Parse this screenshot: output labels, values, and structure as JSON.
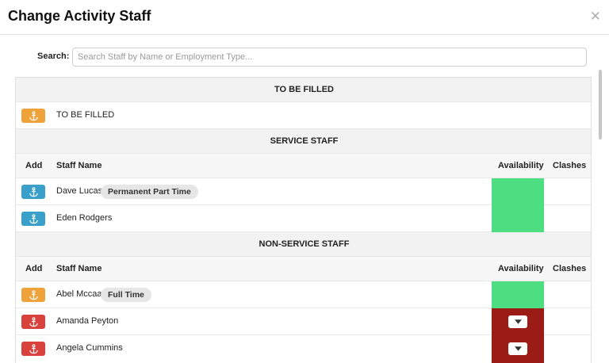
{
  "modal": {
    "title": "Change Activity Staff",
    "close_icon": "close-icon"
  },
  "search": {
    "label": "Search:",
    "placeholder": "Search Staff by Name or Employment Type...",
    "value": ""
  },
  "columns": {
    "add": "Add",
    "staff_name": "Staff Name",
    "availability": "Availability",
    "clashes": "Clashes"
  },
  "sections": {
    "to_be_filled": {
      "title": "TO BE FILLED",
      "rows": [
        {
          "name": "TO BE FILLED",
          "button_color": "orange",
          "icon": "anchor-icon"
        }
      ]
    },
    "service_staff": {
      "title": "SERVICE STAFF",
      "rows": [
        {
          "name": "Dave Lucas",
          "badge": "Permanent Part Time",
          "button_color": "blue",
          "icon": "anchor-icon",
          "availability": "available"
        },
        {
          "name": "Eden Rodgers",
          "badge": "",
          "button_color": "blue",
          "icon": "anchor-icon",
          "availability": "available"
        }
      ]
    },
    "non_service_staff": {
      "title": "NON-SERVICE STAFF",
      "rows": [
        {
          "name": "Abel Mccaa",
          "badge": "Full Time",
          "button_color": "orange",
          "icon": "anchor-icon",
          "availability": "available"
        },
        {
          "name": "Amanda Peyton",
          "badge": "",
          "button_color": "red",
          "icon": "anchor-icon",
          "availability": "unavailable"
        },
        {
          "name": "Angela Cummins",
          "badge": "",
          "button_color": "red",
          "icon": "anchor-icon",
          "availability": "unavailable"
        }
      ]
    }
  },
  "colors": {
    "available": "#4cde80",
    "unavailable": "#9b1b17",
    "button_orange": "#f0a23a",
    "button_blue": "#3aa0c9",
    "button_red": "#d9413c"
  }
}
